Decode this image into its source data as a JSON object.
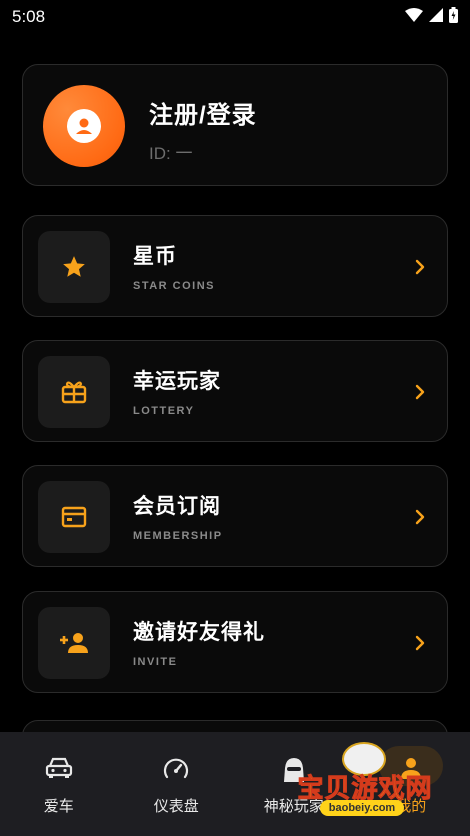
{
  "status_bar": {
    "time": "5:08"
  },
  "profile": {
    "name": "注册/登录",
    "id_text": "ID: 一"
  },
  "menu": [
    {
      "title": "星币",
      "subtitle": "STAR COINS",
      "icon": "star-icon"
    },
    {
      "title": "幸运玩家",
      "subtitle": "LOTTERY",
      "icon": "gift-icon"
    },
    {
      "title": "会员订阅",
      "subtitle": "MEMBERSHIP",
      "icon": "card-icon"
    },
    {
      "title": "邀请好友得礼",
      "subtitle": "INVITE",
      "icon": "person-add-icon"
    }
  ],
  "tabs": [
    {
      "label": "爱车",
      "icon": "car-icon"
    },
    {
      "label": "仪表盘",
      "icon": "speedometer-icon"
    },
    {
      "label": "神秘玩家",
      "icon": "mystery-player-icon"
    },
    {
      "label": "我的",
      "icon": "person-icon",
      "active": true
    }
  ],
  "watermark": {
    "text": "宝贝游戏网",
    "url": "baobeiy.com"
  },
  "colors": {
    "accent": "#f7a21b",
    "avatar": "#ff6a14",
    "background": "#000000",
    "card_border": "#2b2b2b",
    "tab_bar": "#1e1e22"
  }
}
